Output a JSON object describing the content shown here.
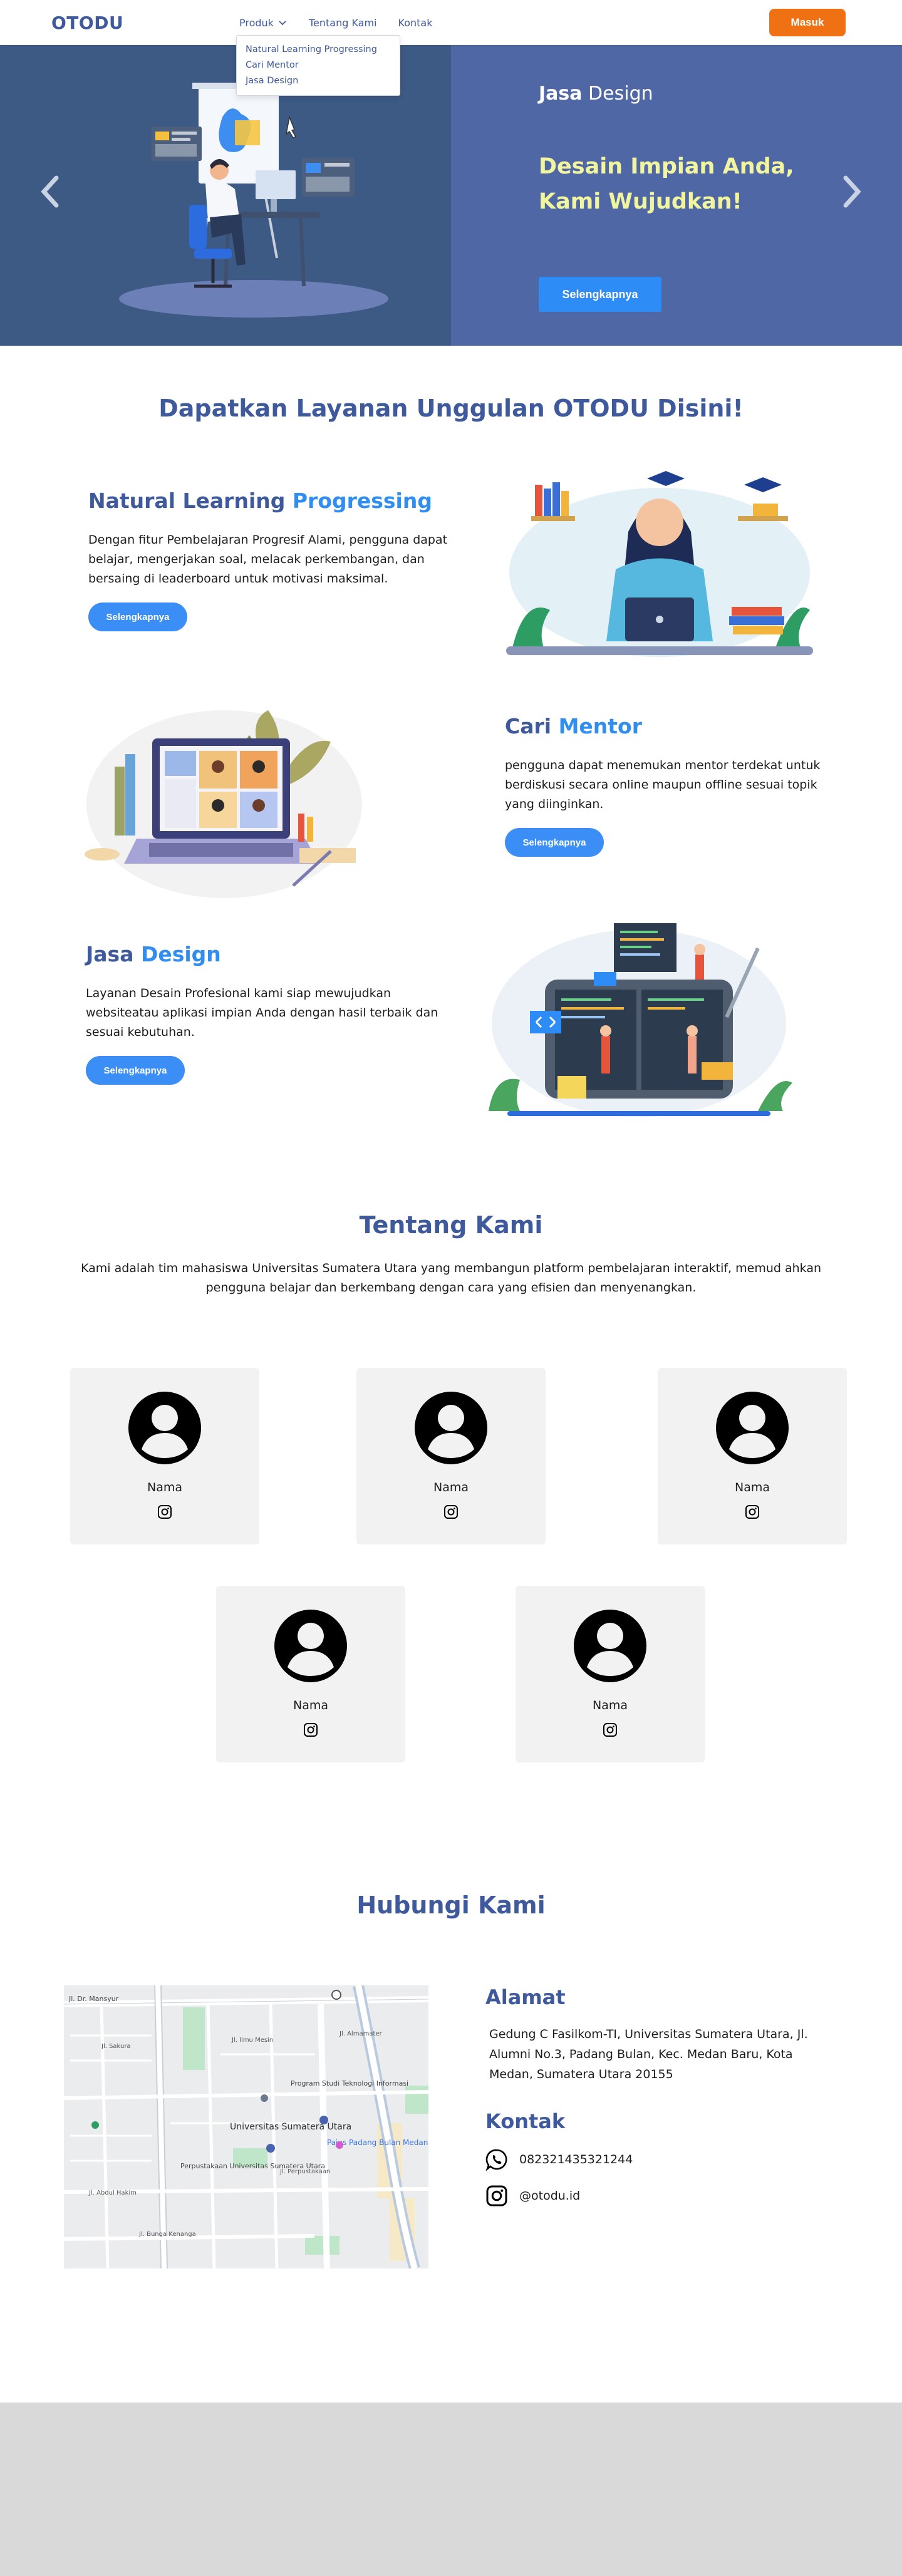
{
  "nav": {
    "logo": "OTODU",
    "links": [
      "Produk",
      "Tentang Kami",
      "Kontak"
    ],
    "dropdown": [
      "Natural Learning Progressing",
      "Cari Mentor",
      "Jasa Design"
    ],
    "login": "Masuk"
  },
  "hero": {
    "tag_bold": "Jasa",
    "tag_rest": " Design",
    "title": "Desain Impian Anda, Kami Wujudkan!",
    "button": "Selengkapnya"
  },
  "services": {
    "title": "Dapatkan Layanan Unggulan OTODU Disini!",
    "items": [
      {
        "h1": "Natural Learning ",
        "h2": "Progressing",
        "desc": "Dengan fitur Pembelajaran Progresif Alami, pengguna dapat belajar, mengerjakan soal, melacak perkembangan, dan bersaing di leaderboard untuk motivasi maksimal.",
        "button": "Selengkapnya"
      },
      {
        "h1": "Cari ",
        "h2": "Mentor",
        "desc": "pengguna dapat menemukan mentor terdekat untuk berdiskusi secara online maupun offline sesuai topik yang diinginkan.",
        "button": "Selengkapnya"
      },
      {
        "h1": "Jasa ",
        "h2": "Design",
        "desc": "Layanan Desain Profesional kami siap mewujudkan websiteatau aplikasi impian Anda dengan hasil terbaik dan sesuai kebutuhan.",
        "button": "Selengkapnya"
      }
    ]
  },
  "about": {
    "title": "Tentang Kami",
    "desc": "Kami adalah tim mahasiswa Universitas Sumatera Utara yang membangun platform pembelajaran interaktif, memud ahkan pengguna belajar dan berkembang dengan cara yang efisien dan menyenangkan.",
    "members": [
      {
        "name": "Nama",
        "icon": "instagram-icon"
      },
      {
        "name": "Nama",
        "icon": "instagram-icon"
      },
      {
        "name": "Nama",
        "icon": "instagram-icon"
      },
      {
        "name": "Nama",
        "icon": "instagram-icon"
      },
      {
        "name": "Nama",
        "icon": "instagram-icon"
      }
    ]
  },
  "contact": {
    "title": "Hubungi Kami",
    "address_heading": "Alamat",
    "address": "Gedung C Fasilkom-TI, Universitas Sumatera Utara, Jl. Alumni No.3, Padang Bulan, Kec. Medan Baru, Kota Medan, Sumatera Utara 20155",
    "contact_heading": "Kontak",
    "phone": "082321435321244",
    "instagram": "@otodu.id"
  },
  "map": {
    "labels": [
      "Jl. Dr. Mansyur",
      "Program Studi Teknologi Informasi",
      "Universitas Sumatera Utara",
      "Perpustakaan Universitas Sumatera Utara",
      "Pajus Padang Bulan Medan",
      "Jl. Abdul Hakim",
      "Jl. Bunga Kenanga",
      "Jl. Sakura",
      "Jl. Ilmu Mesin",
      "Jl. Perpustakaan",
      "Jl. Almamater"
    ]
  },
  "colors": {
    "brand": "#3f5a9c",
    "accent_blue": "#2f8ef0",
    "login_orange": "#f07114",
    "hero_left": "#3d5a85",
    "hero_right": "#4f68a5",
    "hero_title": "#f1f59e"
  }
}
